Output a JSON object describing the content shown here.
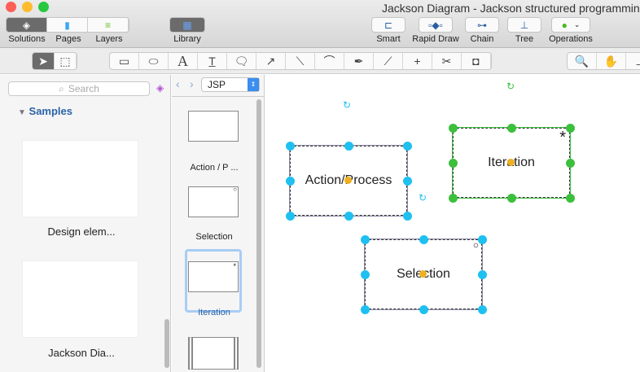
{
  "window": {
    "title": "Jackson Diagram - Jackson structured programming"
  },
  "toolbar": {
    "solutions": "Solutions",
    "pages": "Pages",
    "layers": "Layers",
    "library": "Library",
    "smart": "Smart",
    "rapid_draw": "Rapid Draw",
    "chain": "Chain",
    "tree": "Tree",
    "operations": "Operations"
  },
  "left": {
    "search_placeholder": "Search",
    "section": "Samples",
    "items": [
      {
        "label": "Design elem..."
      },
      {
        "label": "Jackson Dia..."
      }
    ]
  },
  "library": {
    "selected": "JSP",
    "items": [
      {
        "label": "Action / P ..."
      },
      {
        "label": "Selection"
      },
      {
        "label": "Iteration"
      }
    ]
  },
  "canvas": {
    "shapes": [
      {
        "label": "Action/Process"
      },
      {
        "label": "Iteration",
        "marker": "*"
      },
      {
        "label": "Selection",
        "marker": "○"
      }
    ]
  },
  "colors": {
    "handle_blue": "#1ec0f0",
    "handle_green": "#3cbf3c",
    "accent": "#2a63a6"
  }
}
